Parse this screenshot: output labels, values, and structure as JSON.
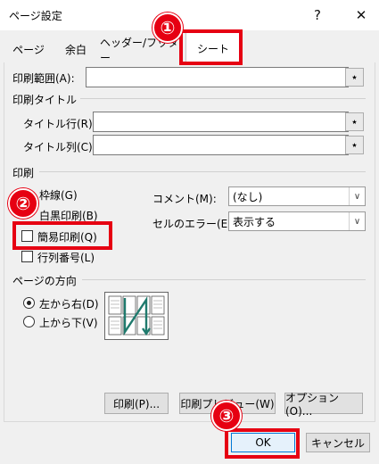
{
  "window": {
    "title": "ページ設定",
    "help_label": "?",
    "close_label": "✕"
  },
  "tabs": [
    {
      "label": "ページ"
    },
    {
      "label": "余白"
    },
    {
      "label": "ヘッダー/フッター"
    },
    {
      "label": "シート",
      "active": true
    }
  ],
  "sheet": {
    "print_area_label": "印刷範囲(A):",
    "print_titles_section": "印刷タイトル",
    "title_rows_label": "タイトル行(R):",
    "title_cols_label": "タイトル列(C):",
    "print_section": "印刷",
    "gridlines_label": "枠線(G)",
    "mono_label": "白黒印刷(B)",
    "draft_label": "簡易印刷(Q)",
    "headings_label": "行列番号(L)",
    "comments_label": "コメント(M):",
    "comments_value": "(なし)",
    "errors_label": "セルのエラー(E):",
    "errors_value": "表示する",
    "page_order_section": "ページの方向",
    "order_down_label": "左から右(D)",
    "order_over_label": "上から下(V)",
    "ref_icon": "collapse-dialog-icon"
  },
  "buttons": {
    "print": "印刷(P)...",
    "preview": "印刷プレビュー(W)",
    "options": "オプション(O)...",
    "ok": "OK",
    "cancel": "キャンセル"
  },
  "annotations": {
    "badge1": "①",
    "badge2": "②",
    "badge3": "③",
    "color": "#e60012"
  }
}
